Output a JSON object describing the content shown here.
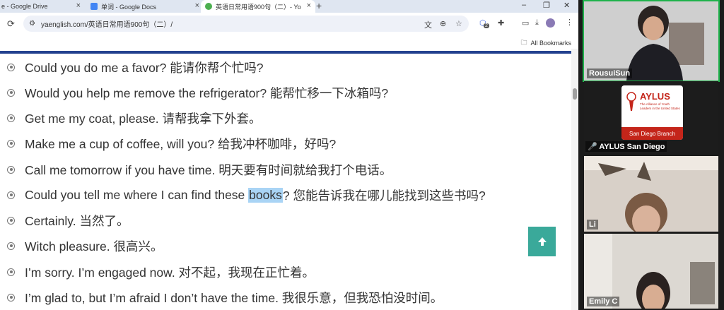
{
  "browser": {
    "tabs": [
      {
        "title": "e - Google Drive",
        "icon_color": "#1ea362",
        "active": false
      },
      {
        "title": "单词 - Google Docs",
        "icon_color": "#4285f4",
        "active": false
      },
      {
        "title": "英语日常用语900句（二）- Yo",
        "icon_color": "#4caf50",
        "active": true
      }
    ],
    "new_tab": "+",
    "window_controls": {
      "minimize": "–",
      "maximize": "❐",
      "close": "✕"
    },
    "url": "yaenglish.com/英语日常用语900句（二）/",
    "extension_badge": "2",
    "all_bookmarks": "All Bookmarks"
  },
  "page": {
    "sentences": [
      {
        "pre": "Could you do me a favor? 能请你帮个忙吗?",
        "hl": "",
        "post": ""
      },
      {
        "pre": "Would you help me remove the refrigerator? 能帮忙移一下冰箱吗?",
        "hl": "",
        "post": ""
      },
      {
        "pre": "Get me my coat, please. 请帮我拿下外套。",
        "hl": "",
        "post": ""
      },
      {
        "pre": "Make me a cup of coffee, will you? 给我冲杯咖啡，好吗?",
        "hl": "",
        "post": ""
      },
      {
        "pre": "Call me tomorrow if you have time. 明天要有时间就给我打个电话。",
        "hl": "",
        "post": ""
      },
      {
        "pre": "Could you tell me where I can find these ",
        "hl": "books",
        "post": "? 您能告诉我在哪儿能找到这些书吗?"
      },
      {
        "pre": "Certainly. 当然了。",
        "hl": "",
        "post": ""
      },
      {
        "pre": "Witch pleasure. 很高兴。",
        "hl": "",
        "post": ""
      },
      {
        "pre": "I’m sorry. I’m engaged now. 对不起，我现在正忙着。",
        "hl": "",
        "post": ""
      },
      {
        "pre": "I’m glad to, but I’m afraid I don’t have the time. 我很乐意，但我恐怕没时间。",
        "hl": "",
        "post": ""
      }
    ],
    "highlight_color": "#a9d4f5"
  },
  "participants": [
    {
      "name": "RousuiSun",
      "active_speaker": true
    },
    {
      "name": "AYLUS San Diego",
      "muted": true,
      "logo": {
        "title": "AYLUS",
        "subtitle": "The Alliance of Youth Leaders in the United States",
        "branch": "San Diego Branch"
      }
    },
    {
      "name": "Li"
    },
    {
      "name": "Emily C"
    }
  ]
}
